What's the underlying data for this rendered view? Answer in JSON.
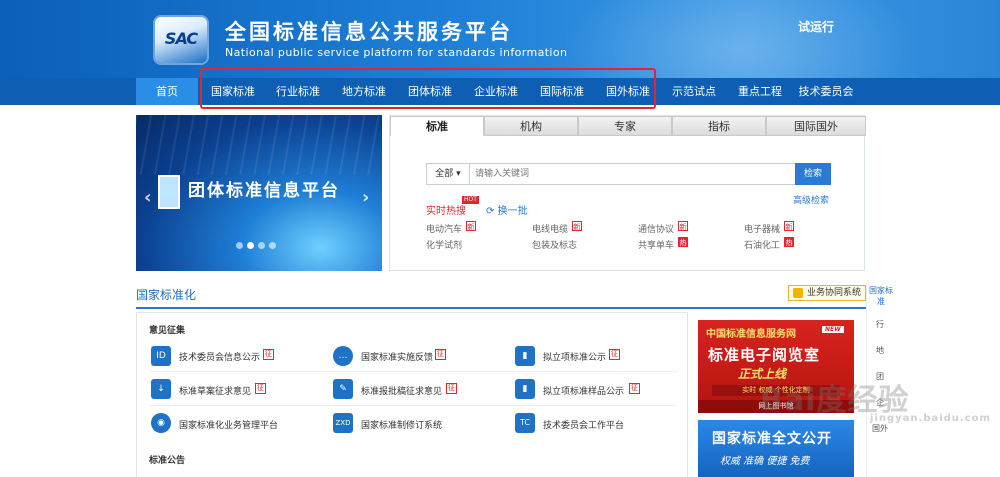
{
  "header": {
    "logo_text": "SAC",
    "title": "全国标准信息公共服务平台",
    "subtitle": "National public service platform  for standards information",
    "status": "试运行"
  },
  "nav": {
    "items": [
      "首页",
      "国家标准",
      "行业标准",
      "地方标准",
      "团体标准",
      "企业标准",
      "国际标准",
      "国外标准",
      "示范试点",
      "重点工程",
      "技术委员会"
    ]
  },
  "banner": {
    "title": "团体标准信息平台",
    "prev": "‹",
    "next": "›"
  },
  "search": {
    "tabs": [
      "标准",
      "机构",
      "专家",
      "指标",
      "国际国外"
    ],
    "dropdown": "全部 ▾",
    "placeholder": "请输入关键词",
    "button": "检索",
    "advanced": "高级检索",
    "hot_label": "实时热搜",
    "hot_badge": "HOT",
    "refresh": "换一批",
    "keywords": [
      {
        "text": "电动汽车",
        "badge": "新",
        "hot": false
      },
      {
        "text": "电线电缆",
        "badge": "新",
        "hot": false
      },
      {
        "text": "通信协议",
        "badge": "新",
        "hot": false
      },
      {
        "text": "电子器械",
        "badge": "新",
        "hot": false
      },
      {
        "text": "化学试剂",
        "badge": "",
        "hot": false
      },
      {
        "text": "包装及标志",
        "badge": "",
        "hot": false
      },
      {
        "text": "共享单车",
        "badge": "热",
        "hot": true
      },
      {
        "text": "石油化工",
        "badge": "热",
        "hot": true
      }
    ]
  },
  "section": {
    "title": "国家标准化",
    "coop_button": "业务协同系统",
    "sub1": "意见征集",
    "sub2": "标准公告",
    "items": [
      {
        "label": "技术委员会信息公示",
        "tag": "征",
        "icon": "ID"
      },
      {
        "label": "国家标准实施反馈",
        "tag": "征",
        "icon": "…"
      },
      {
        "label": "拟立项标准公示",
        "tag": "征",
        "icon": "▮"
      },
      {
        "label": "标准草案征求意见",
        "tag": "征",
        "icon": "↓"
      },
      {
        "label": "标准报批稿征求意见",
        "tag": "征",
        "icon": "✎"
      },
      {
        "label": "拟立项标准样品公示",
        "tag": "征",
        "icon": "▮"
      },
      {
        "label": "国家标准化业务管理平台",
        "tag": "",
        "icon": "◉"
      },
      {
        "label": "国家标准制修订系统",
        "tag": "",
        "icon": "ZXD"
      },
      {
        "label": "技术委员会工作平台",
        "tag": "",
        "icon": "TC"
      }
    ]
  },
  "ads": {
    "ad1_top": "中国标准信息服务网",
    "ad1_new": "NEW",
    "ad1_title": "标准电子阅览室",
    "ad1_slogan": "正式上线",
    "ad1_features": "实时  权威  个性化定制",
    "ad1_footer": "网上图书馆",
    "ad2_title": "国家标准全文公开",
    "ad2_sub": "权威  准确  便捷  免费"
  },
  "side_nav": [
    "国家标准",
    "行",
    "地",
    "团",
    "企",
    "国外"
  ],
  "watermark": {
    "main": "Bai度经验",
    "sub": "jingyan.baidu.com"
  }
}
